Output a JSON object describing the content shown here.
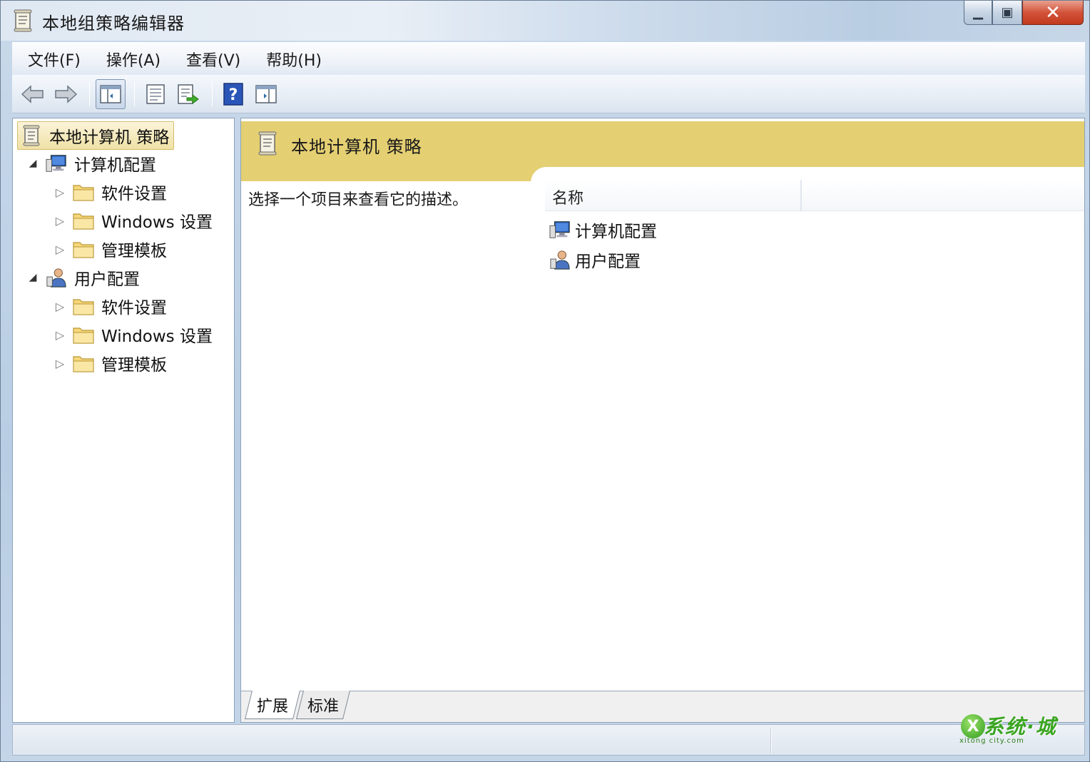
{
  "window": {
    "title": "本地组策略编辑器",
    "minimize_glyph": "▁",
    "maximize_glyph": "▣",
    "close_glyph": "✕"
  },
  "menu": [
    {
      "label": "文件(F)"
    },
    {
      "label": "操作(A)"
    },
    {
      "label": "查看(V)"
    },
    {
      "label": "帮助(H)"
    }
  ],
  "toolbar": {
    "buttons": [
      "back-icon",
      "forward-icon",
      "show-hide-tree-icon",
      "properties-icon",
      "export-list-icon",
      "help-icon",
      "show-hide-action-pane-icon"
    ],
    "help_glyph": "?"
  },
  "tree": {
    "root": {
      "label": "本地计算机 策略"
    },
    "computer": {
      "label": "计算机配置",
      "children": [
        {
          "label": "软件设置"
        },
        {
          "label": "Windows 设置"
        },
        {
          "label": "管理模板"
        }
      ]
    },
    "user": {
      "label": "用户配置",
      "children": [
        {
          "label": "软件设置"
        },
        {
          "label": "Windows 设置"
        },
        {
          "label": "管理模板"
        }
      ]
    },
    "expanded_glyph": "◢",
    "collapsed_glyph": "▷"
  },
  "content": {
    "header_title": "本地计算机 策略",
    "description": "选择一个项目来查看它的描述。",
    "column_name": "名称",
    "items": [
      {
        "label": "计算机配置"
      },
      {
        "label": "用户配置"
      }
    ]
  },
  "tabs": [
    {
      "label": "扩展",
      "selected": true
    },
    {
      "label": "标准",
      "selected": false
    }
  ],
  "watermark": {
    "logo_letter": "X",
    "text": "系统·城",
    "sub": "xitong city.com"
  },
  "colors": {
    "header_gold": "#e4cf72",
    "selection_gold": "#efe1a6",
    "close_red": "#d2533a"
  }
}
